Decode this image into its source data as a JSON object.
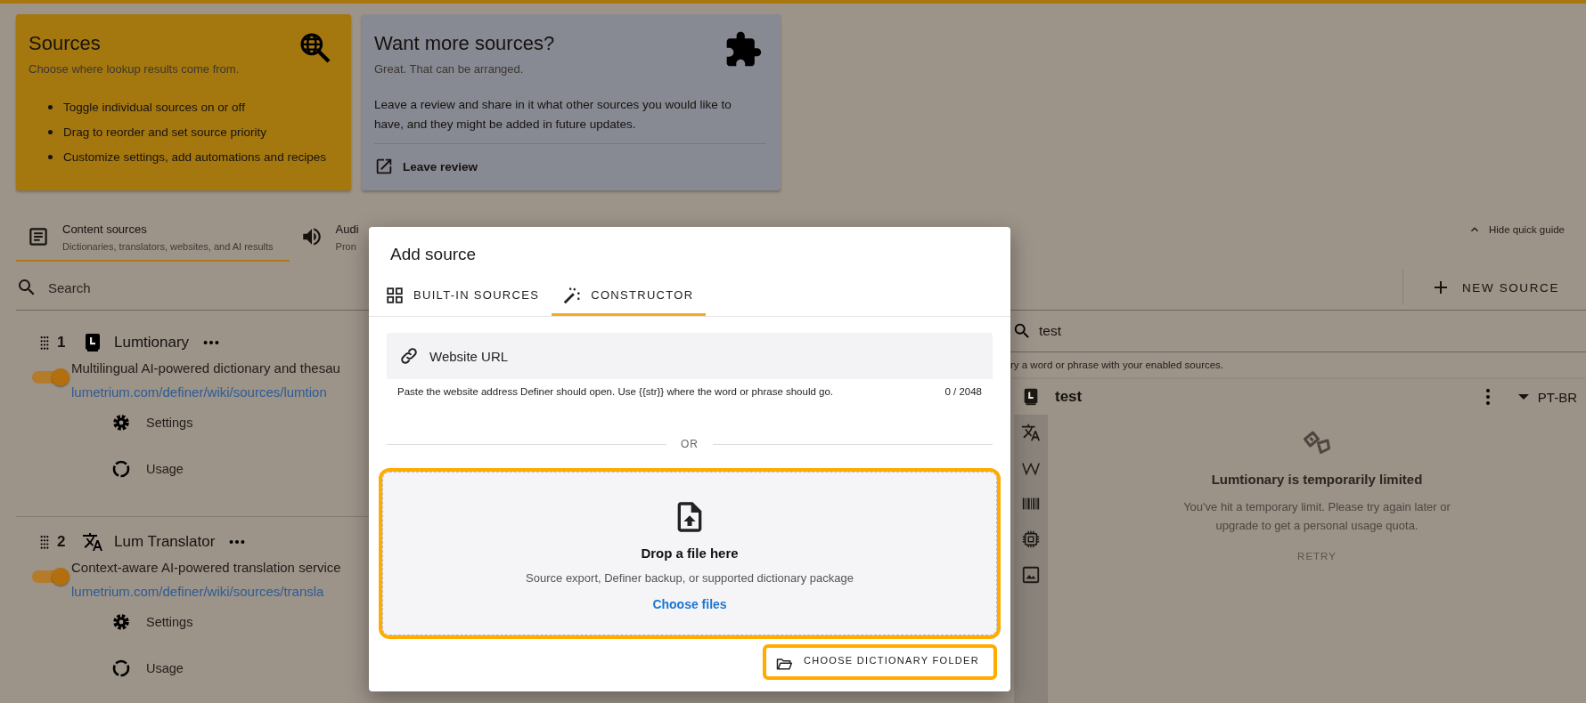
{
  "guide": {
    "cards": [
      {
        "kind": "intro",
        "title": "Sources",
        "subtitle": "Choose where lookup results come from.",
        "bullets": [
          "Toggle individual sources on or off",
          "Drag to reorder and set source priority",
          "Customize settings, add automations and recipes"
        ]
      },
      {
        "kind": "promo",
        "title": "Want more sources?",
        "subtitle": "Great. That can be arranged.",
        "body": "Leave a review and share in it what other sources you would like to have, and they might be added in future updates.",
        "action": "Leave review"
      }
    ],
    "hide_label": "Hide quick guide"
  },
  "tabs": [
    {
      "kind": "content",
      "title": "Content sources",
      "subtitle": "Dictionaries, translators, websites, and AI results",
      "selected": true
    },
    {
      "kind": "audio",
      "title": "Audi",
      "subtitle": "Pron",
      "selected": false
    }
  ],
  "search": {
    "placeholder": "Search"
  },
  "new_source_button": "NEW SOURCE",
  "sources": [
    {
      "index": "1",
      "kind": "dictionary",
      "name": "Lumtionary",
      "description": "Multilingual AI-powered dictionary and thesau",
      "link": "lumetrium.com/definer/wiki/sources/lumtion",
      "on": true,
      "actions": [
        {
          "kind": "settings",
          "label": "Settings"
        },
        {
          "kind": "usage",
          "label": "Usage"
        }
      ]
    },
    {
      "index": "2",
      "kind": "translator",
      "name": "Lum Translator",
      "description": "Context-aware AI-powered translation service",
      "link": "lumetrium.com/definer/wiki/sources/transla",
      "on": true,
      "actions": [
        {
          "kind": "settings",
          "label": "Settings"
        },
        {
          "kind": "usage",
          "label": "Usage"
        }
      ]
    }
  ],
  "preview": {
    "query": "test",
    "hint": "ry a word or phrase with your enabled sources.",
    "rail": [
      {
        "kind": "dictionary",
        "selected": true
      },
      {
        "kind": "translator",
        "selected": false
      },
      {
        "kind": "wiki",
        "selected": false
      },
      {
        "kind": "barcode",
        "selected": false
      },
      {
        "kind": "chip",
        "selected": false
      },
      {
        "kind": "image",
        "selected": false
      }
    ],
    "title": "test",
    "language": "PT-BR",
    "empty": {
      "title": "Lumtionary is temporarily limited",
      "text": "You've hit a temporary limit. Please try again later or upgrade to get a personal usage quota.",
      "action": "RETRY"
    }
  },
  "dialog": {
    "title": "Add source",
    "tabs": [
      {
        "kind": "grid",
        "label": "BUILT-IN SOURCES",
        "selected": false
      },
      {
        "kind": "wand",
        "label": "CONSTRUCTOR",
        "selected": true
      }
    ],
    "url_field": {
      "label": "Website URL",
      "hint": "Paste the website address Definer should open. Use {{str}} where the word or phrase should go.",
      "counter": "0 / 2048"
    },
    "separator": "OR",
    "dropzone": {
      "title": "Drop a file here",
      "text": "Source export, Definer backup, or supported dictionary package",
      "link": "Choose files",
      "highlighted": true
    },
    "folder_button": {
      "label": "CHOOSE DICTIONARY FOLDER",
      "highlighted": true
    }
  }
}
